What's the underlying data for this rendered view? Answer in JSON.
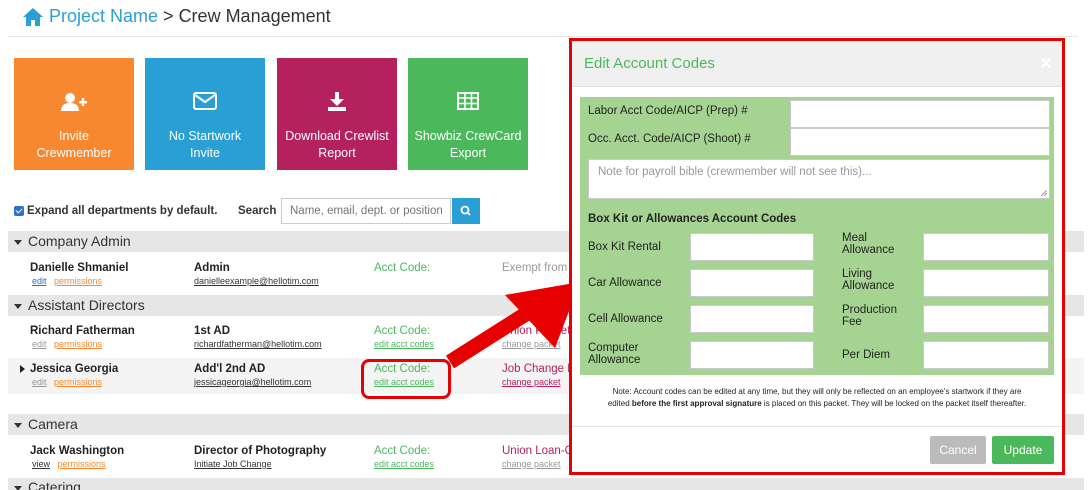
{
  "breadcrumb": {
    "project": "Project Name",
    "sep": " > ",
    "page": "Crew Management"
  },
  "tiles": [
    {
      "line1": "Invite",
      "line2": "Crewmember",
      "icon": "add-user-icon"
    },
    {
      "line1": "No Startwork",
      "line2": "Invite",
      "icon": "envelope-icon"
    },
    {
      "line1": "Download Crewlist",
      "line2": "Report",
      "icon": "download-icon"
    },
    {
      "line1": "Showbiz CrewCard",
      "line2": "Export",
      "icon": "table-icon"
    }
  ],
  "controls": {
    "expand_label": "Expand all departments by default.",
    "search_label": "Search",
    "search_placeholder": "Name, email, dept. or position"
  },
  "departments": {
    "d1": "Company Admin",
    "d2": "Assistant Directors",
    "d3": "Camera",
    "d4": "Catering"
  },
  "rows": {
    "r1": {
      "name": "Danielle Shmaniel",
      "a": "edit",
      "b": "permissions",
      "role": "Admin",
      "email": "danielleexample@hellotim.com",
      "acct": "Acct Code:",
      "status": "Exempt from"
    },
    "r2": {
      "name": "Richard Fatherman",
      "a": "edit",
      "b": "permissions",
      "role": "1st AD",
      "email": "richardfatherman@hellotim.com",
      "acct": "Acct Code:",
      "acct_link": "edit acct codes",
      "status": "Union Packet",
      "status_link": "change packet"
    },
    "r3": {
      "name": "Jessica Georgia",
      "a": "edit",
      "b": "permissions",
      "role": "Add'l 2nd AD",
      "email": "jessicageorgia@hellotim.com",
      "acct": "Acct Code:",
      "acct_link": "edit acct codes",
      "status": "Job Change P",
      "status_link": "change packet"
    },
    "r4": {
      "name": "Jack Washington",
      "a": "view",
      "b": "permissions",
      "role": "Director of Photography",
      "email": "Initiate Job Change",
      "acct": "Acct Code:",
      "acct_link": "edit acct codes",
      "status": "Union Loan-O",
      "status_link": "change packet"
    }
  },
  "modal": {
    "title": "Edit Account Codes",
    "close": "×",
    "labor_label": "Labor Acct Code/AICP (Prep) #",
    "occ_label": "Occ. Acct. Code/AICP (Shoot) #",
    "note_placeholder": "Note for payroll bible (crewmember will not see this)...",
    "section_title": "Box Kit or Allowances Account Codes",
    "box_kit": "Box Kit Rental",
    "car": "Car Allowance",
    "cell": "Cell Allowance",
    "computer1": "Computer",
    "computer2": "Allowance",
    "meal1": "Meal",
    "meal2": "Allowance",
    "living1": "Living",
    "living2": "Allowance",
    "prod1": "Production",
    "prod2": "Fee",
    "per_diem": "Per Diem",
    "footnote_a": "Note: Account codes can be edited at any time, but they will only be reflected on an employee's startwork if they are",
    "footnote_b1": "edited ",
    "footnote_b2": "before the first approval signature",
    "footnote_b3": " is placed on this packet. They will be locked on the packet itself thereafter.",
    "cancel": "Cancel",
    "update": "Update"
  },
  "colors": {
    "accent_blue": "#2a9fd6",
    "orange": "#f7882f",
    "magenta": "#b5205f",
    "green": "#4cb85c",
    "highlight_red": "#e60000"
  }
}
